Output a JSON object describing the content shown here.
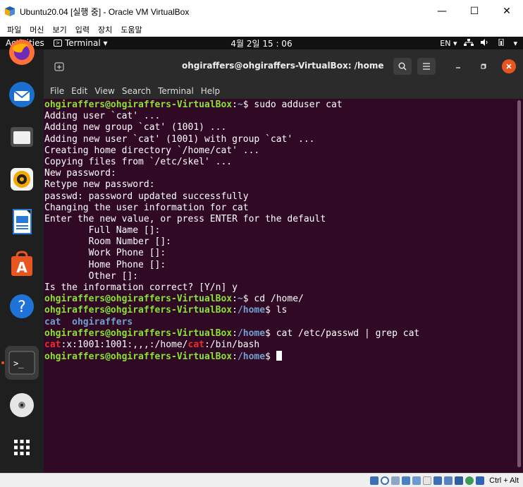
{
  "vbox": {
    "title": "Ubuntu20.04 [실행 중] - Oracle VM VirtualBox",
    "minimize": "—",
    "maximize": "☐",
    "close": "✕",
    "menu": [
      "파일",
      "머신",
      "보기",
      "입력",
      "장치",
      "도움말"
    ],
    "host_key": "Ctrl + Alt"
  },
  "ubuntu": {
    "activities": "Activities",
    "app_menu": "Terminal ▾",
    "clock": "4월 2일 15 : 06",
    "input_method": "EN ▾",
    "dock": [
      "firefox-icon",
      "thunderbird-icon",
      "files-icon",
      "rhythmbox-icon",
      "libreoffice-writer-icon",
      "software-icon",
      "help-icon",
      "terminal-icon",
      "dvd-icon",
      "show-apps-icon"
    ]
  },
  "terminal": {
    "title": "ohgiraffers@ohgiraffers-VirtualBox: /home",
    "menu": [
      "File",
      "Edit",
      "View",
      "Search",
      "Terminal",
      "Help"
    ],
    "user_host": "ohgiraffers@ohgiraffers-VirtualBox",
    "lines": [
      {
        "t": "p",
        "path": "~",
        "cmd": "sudo adduser cat"
      },
      {
        "t": "o",
        "text": "Adding user `cat' ..."
      },
      {
        "t": "o",
        "text": "Adding new group `cat' (1001) ..."
      },
      {
        "t": "o",
        "text": "Adding new user `cat' (1001) with group `cat' ..."
      },
      {
        "t": "o",
        "text": "Creating home directory `/home/cat' ..."
      },
      {
        "t": "o",
        "text": "Copying files from `/etc/skel' ..."
      },
      {
        "t": "o",
        "text": "New password:"
      },
      {
        "t": "o",
        "text": "Retype new password:"
      },
      {
        "t": "o",
        "text": "passwd: password updated successfully"
      },
      {
        "t": "o",
        "text": "Changing the user information for cat"
      },
      {
        "t": "o",
        "text": "Enter the new value, or press ENTER for the default"
      },
      {
        "t": "o",
        "text": "        Full Name []:"
      },
      {
        "t": "o",
        "text": "        Room Number []:"
      },
      {
        "t": "o",
        "text": "        Work Phone []:"
      },
      {
        "t": "o",
        "text": "        Home Phone []:"
      },
      {
        "t": "o",
        "text": "        Other []:"
      },
      {
        "t": "o",
        "text": "Is the information correct? [Y/n] y"
      },
      {
        "t": "p",
        "path": "~",
        "cmd": "cd /home/"
      },
      {
        "t": "p",
        "path": "/home",
        "cmd": "ls"
      },
      {
        "t": "ls",
        "items": [
          "cat",
          "ohgiraffers"
        ]
      },
      {
        "t": "p",
        "path": "/home",
        "cmd": "cat /etc/passwd | grep cat"
      },
      {
        "t": "grep",
        "parts": [
          [
            "cat",
            true
          ],
          [
            ":x:1001:1001:,,,:/home/",
            false
          ],
          [
            "cat",
            true
          ],
          [
            ":/bin/bash",
            false
          ]
        ]
      },
      {
        "t": "p",
        "path": "/home",
        "cmd": "",
        "cursor": true
      }
    ]
  }
}
